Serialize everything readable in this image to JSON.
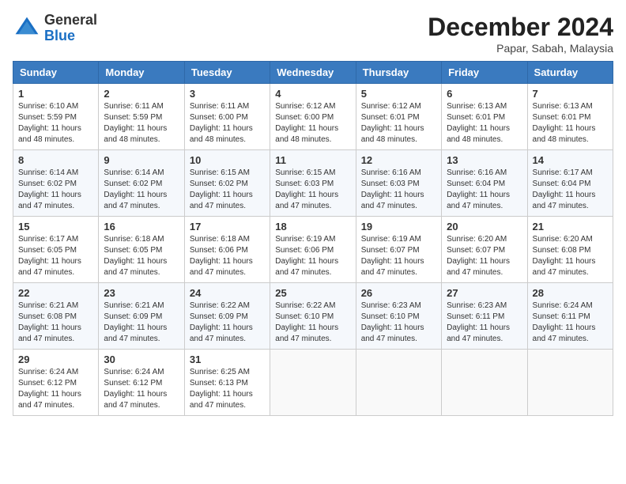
{
  "header": {
    "logo_general": "General",
    "logo_blue": "Blue",
    "main_title": "December 2024",
    "sub_title": "Papar, Sabah, Malaysia"
  },
  "weekdays": [
    "Sunday",
    "Monday",
    "Tuesday",
    "Wednesday",
    "Thursday",
    "Friday",
    "Saturday"
  ],
  "weeks": [
    [
      {
        "day": "1",
        "sunrise": "6:10 AM",
        "sunset": "5:59 PM",
        "daylight": "11 hours and 48 minutes."
      },
      {
        "day": "2",
        "sunrise": "6:11 AM",
        "sunset": "5:59 PM",
        "daylight": "11 hours and 48 minutes."
      },
      {
        "day": "3",
        "sunrise": "6:11 AM",
        "sunset": "6:00 PM",
        "daylight": "11 hours and 48 minutes."
      },
      {
        "day": "4",
        "sunrise": "6:12 AM",
        "sunset": "6:00 PM",
        "daylight": "11 hours and 48 minutes."
      },
      {
        "day": "5",
        "sunrise": "6:12 AM",
        "sunset": "6:01 PM",
        "daylight": "11 hours and 48 minutes."
      },
      {
        "day": "6",
        "sunrise": "6:13 AM",
        "sunset": "6:01 PM",
        "daylight": "11 hours and 48 minutes."
      },
      {
        "day": "7",
        "sunrise": "6:13 AM",
        "sunset": "6:01 PM",
        "daylight": "11 hours and 48 minutes."
      }
    ],
    [
      {
        "day": "8",
        "sunrise": "6:14 AM",
        "sunset": "6:02 PM",
        "daylight": "11 hours and 47 minutes."
      },
      {
        "day": "9",
        "sunrise": "6:14 AM",
        "sunset": "6:02 PM",
        "daylight": "11 hours and 47 minutes."
      },
      {
        "day": "10",
        "sunrise": "6:15 AM",
        "sunset": "6:02 PM",
        "daylight": "11 hours and 47 minutes."
      },
      {
        "day": "11",
        "sunrise": "6:15 AM",
        "sunset": "6:03 PM",
        "daylight": "11 hours and 47 minutes."
      },
      {
        "day": "12",
        "sunrise": "6:16 AM",
        "sunset": "6:03 PM",
        "daylight": "11 hours and 47 minutes."
      },
      {
        "day": "13",
        "sunrise": "6:16 AM",
        "sunset": "6:04 PM",
        "daylight": "11 hours and 47 minutes."
      },
      {
        "day": "14",
        "sunrise": "6:17 AM",
        "sunset": "6:04 PM",
        "daylight": "11 hours and 47 minutes."
      }
    ],
    [
      {
        "day": "15",
        "sunrise": "6:17 AM",
        "sunset": "6:05 PM",
        "daylight": "11 hours and 47 minutes."
      },
      {
        "day": "16",
        "sunrise": "6:18 AM",
        "sunset": "6:05 PM",
        "daylight": "11 hours and 47 minutes."
      },
      {
        "day": "17",
        "sunrise": "6:18 AM",
        "sunset": "6:06 PM",
        "daylight": "11 hours and 47 minutes."
      },
      {
        "day": "18",
        "sunrise": "6:19 AM",
        "sunset": "6:06 PM",
        "daylight": "11 hours and 47 minutes."
      },
      {
        "day": "19",
        "sunrise": "6:19 AM",
        "sunset": "6:07 PM",
        "daylight": "11 hours and 47 minutes."
      },
      {
        "day": "20",
        "sunrise": "6:20 AM",
        "sunset": "6:07 PM",
        "daylight": "11 hours and 47 minutes."
      },
      {
        "day": "21",
        "sunrise": "6:20 AM",
        "sunset": "6:08 PM",
        "daylight": "11 hours and 47 minutes."
      }
    ],
    [
      {
        "day": "22",
        "sunrise": "6:21 AM",
        "sunset": "6:08 PM",
        "daylight": "11 hours and 47 minutes."
      },
      {
        "day": "23",
        "sunrise": "6:21 AM",
        "sunset": "6:09 PM",
        "daylight": "11 hours and 47 minutes."
      },
      {
        "day": "24",
        "sunrise": "6:22 AM",
        "sunset": "6:09 PM",
        "daylight": "11 hours and 47 minutes."
      },
      {
        "day": "25",
        "sunrise": "6:22 AM",
        "sunset": "6:10 PM",
        "daylight": "11 hours and 47 minutes."
      },
      {
        "day": "26",
        "sunrise": "6:23 AM",
        "sunset": "6:10 PM",
        "daylight": "11 hours and 47 minutes."
      },
      {
        "day": "27",
        "sunrise": "6:23 AM",
        "sunset": "6:11 PM",
        "daylight": "11 hours and 47 minutes."
      },
      {
        "day": "28",
        "sunrise": "6:24 AM",
        "sunset": "6:11 PM",
        "daylight": "11 hours and 47 minutes."
      }
    ],
    [
      {
        "day": "29",
        "sunrise": "6:24 AM",
        "sunset": "6:12 PM",
        "daylight": "11 hours and 47 minutes."
      },
      {
        "day": "30",
        "sunrise": "6:24 AM",
        "sunset": "6:12 PM",
        "daylight": "11 hours and 47 minutes."
      },
      {
        "day": "31",
        "sunrise": "6:25 AM",
        "sunset": "6:13 PM",
        "daylight": "11 hours and 47 minutes."
      },
      null,
      null,
      null,
      null
    ]
  ]
}
